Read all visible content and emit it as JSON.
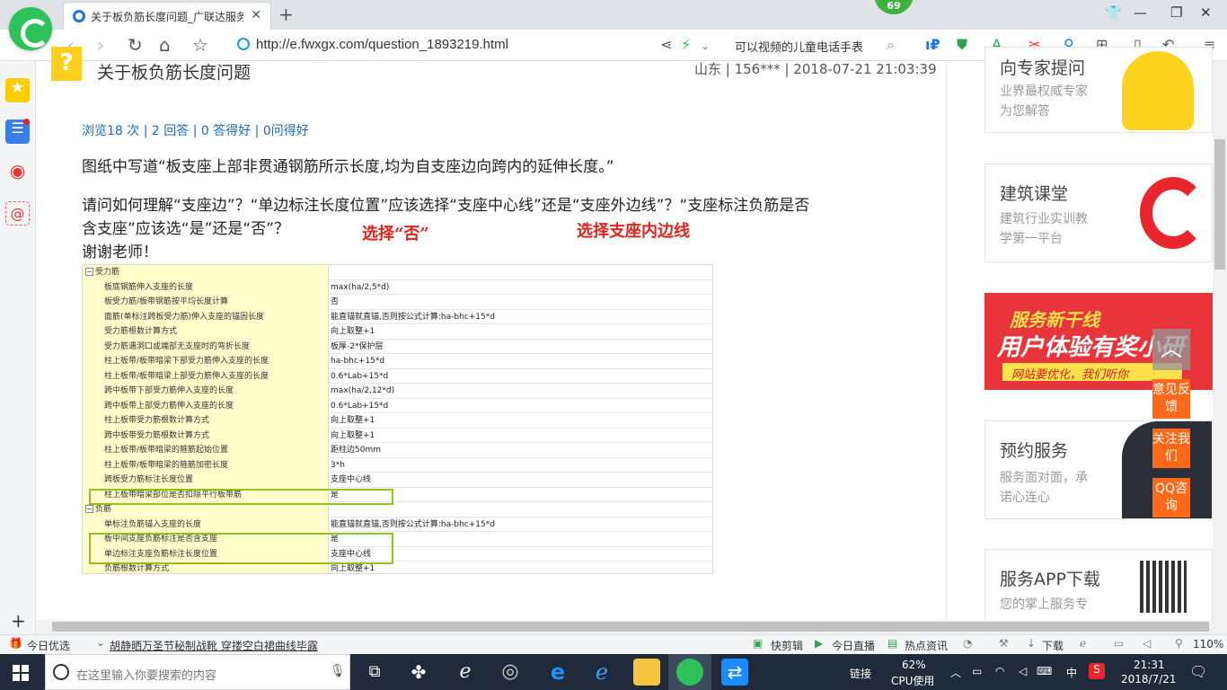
{
  "browser": {
    "tab_title": "关于板负筋长度问题_广联达服务",
    "url": "http://e.fwxgx.com/question_1893219.html",
    "badge": "69",
    "search_text": "可以视频的儿童电话手表"
  },
  "question": {
    "title": "关于板负筋长度问题",
    "meta": "山东 | 156*** | 2018-07-21 21:03:39",
    "stats": "浏览18 次 | 2 回答 | 0 答得好 | 0问得好",
    "para1": "图纸中写道“板支座上部非贯通钢筋所示长度,均为自支座边向跨内的延伸长度。”",
    "para2_line1": "请问如何理解“支座边”？“单边标注长度位置”应该选择“支座中心线”还是“支座外边线”？“支座标注负筋是否",
    "para2_line2": "含支座”应该选“是”还是“否”？",
    "thanks": "谢谢老师！",
    "note_no": "选择“否”",
    "note_edge": "选择支座内边线"
  },
  "settings": {
    "groups": [
      {
        "name": "受力筋",
        "rows": [
          {
            "name": "板底钢筋伸入支座的长度",
            "value": "max(ha/2,5*d)"
          },
          {
            "name": "板受力筋/板带钢筋按平均长度计算",
            "value": "否"
          },
          {
            "name": "面筋(单标注跨板受力筋)伸入支座的锚固长度",
            "value": "能直锚就直锚,否则按公式计算:ha-bhc+15*d"
          },
          {
            "name": "受力筋根数计算方式",
            "value": "向上取整+1"
          },
          {
            "name": "受力筋遇洞口或端部无支座时的弯折长度",
            "value": "板厚-2*保护层"
          },
          {
            "name": "柱上板带/板带暗梁下部受力筋伸入支座的长度",
            "value": "ha-bhc+15*d"
          },
          {
            "name": "柱上板带/板带暗梁上部受力筋伸入支座的长度",
            "value": "0.6*Lab+15*d"
          },
          {
            "name": "跨中板带下部受力筋伸入支座的长度",
            "value": "max(ha/2,12*d)"
          },
          {
            "name": "跨中板带上部受力筋伸入支座的长度",
            "value": "0.6*Lab+15*d"
          },
          {
            "name": "柱上板带受力筋根数计算方式",
            "value": "向上取整+1"
          },
          {
            "name": "跨中板带受力筋根数计算方式",
            "value": "向上取整+1"
          },
          {
            "name": "柱上板带/板带暗梁的箍筋起始位置",
            "value": "距柱边50mm"
          },
          {
            "name": "柱上板带/板带暗梁的箍筋加密长度",
            "value": "3*h"
          },
          {
            "name": "跨板受力筋标注长度位置",
            "value": "支座中心线"
          },
          {
            "name": "柱上板带暗梁部位是否扣除平行板带筋",
            "value": "是"
          }
        ]
      },
      {
        "name": "负筋",
        "rows": [
          {
            "name": "单标注负筋锚入支座的长度",
            "value": "能直锚就直锚,否则按公式计算:ha-bhc+15*d"
          },
          {
            "name": "板中间支座负筋标注是否含支座",
            "value": "是"
          },
          {
            "name": "单边标注支座负筋标注长度位置",
            "value": "支座中心线"
          },
          {
            "name": "负筋根数计算方式",
            "value": "向上取整+1"
          }
        ]
      }
    ]
  },
  "right": {
    "expert_title": "向专家提问",
    "expert_sub1": "业界最权威专家",
    "expert_sub2": "为您解答",
    "class_title": "建筑课堂",
    "class_sub1": "建筑行业实训教",
    "class_sub2": "学第一平台",
    "banner_line1": "服务新干线",
    "banner_line2": "用户体验有奖小研",
    "banner_line3": "网站要优化，我们听你",
    "booking_title": "预约服务",
    "booking_sub1": "服务面对面，承",
    "booking_sub2": "诺心连心",
    "app_title": "服务APP下载",
    "app_sub": "您的掌上服务专",
    "float_feedback": "意见反馈",
    "float_follow": "关注我们",
    "float_qq": "QQ咨询"
  },
  "statusbar": {
    "today": "今日优选",
    "news": "胡静晒万圣节秘制战靴 穿搂空白裙曲线毕露",
    "kuaijianji": "快剪辑",
    "live": "今日直播",
    "hot": "热点资讯",
    "download": "下载",
    "zoom": "110%"
  },
  "taskbar": {
    "search_placeholder": "在这里输入你要搜索的内容",
    "link": "链接",
    "cpu": "62%",
    "cpu_label": "CPU使用",
    "ime": "中",
    "time": "21:31",
    "date": "2018/7/21"
  },
  "colors": {
    "accent_blue": "#1f6bb5",
    "note_red": "#e0241d",
    "highlight_green": "#95c11f",
    "float_orange": "#ff6a1a"
  }
}
